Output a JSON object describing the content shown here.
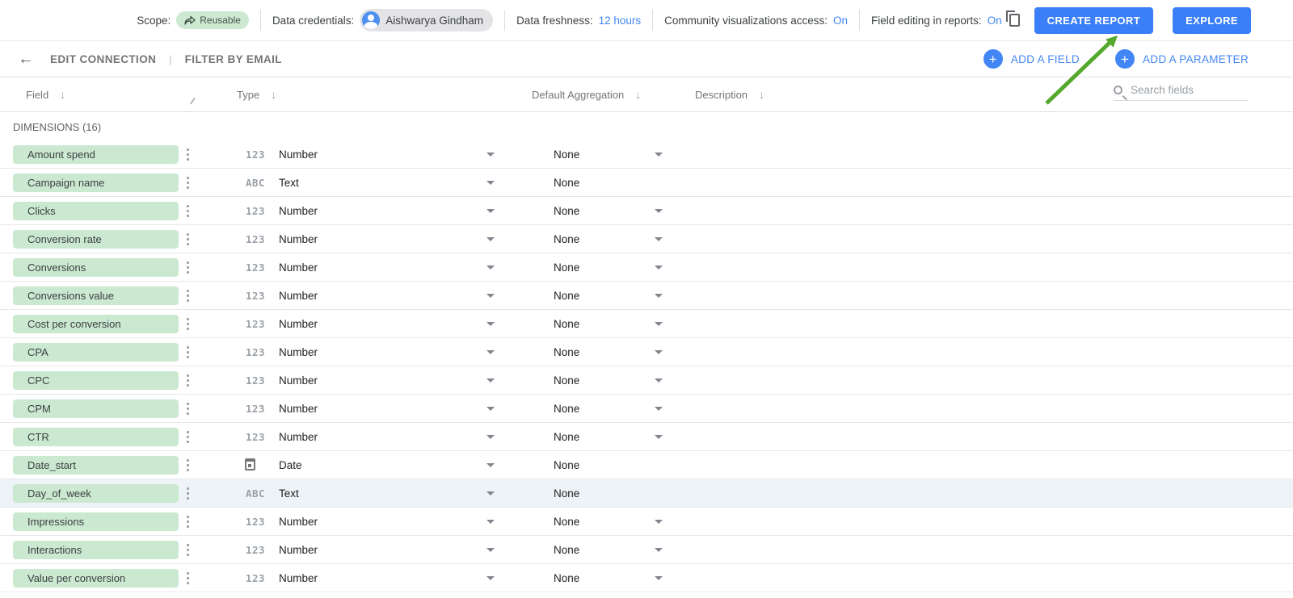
{
  "topbar": {
    "scope_label": "Scope:",
    "scope_value": "Reusable",
    "credentials_label": "Data credentials:",
    "credentials_value": "Aishwarya Gindham",
    "freshness_label": "Data freshness:",
    "freshness_value": "12 hours",
    "community_label": "Community visualizations access:",
    "community_value": "On",
    "field_editing_label": "Field editing in reports:",
    "field_editing_value": "On",
    "create_report_label": "CREATE REPORT",
    "explore_label": "EXPLORE"
  },
  "toolbar": {
    "edit_connection_label": "EDIT CONNECTION",
    "separator": "|",
    "filter_by_email_label": "FILTER BY EMAIL",
    "add_field_label": "ADD A FIELD",
    "add_parameter_label": "ADD A PARAMETER"
  },
  "table": {
    "columns": [
      {
        "label": "Field"
      },
      {
        "label": "Type"
      },
      {
        "label": "Default Aggregation"
      },
      {
        "label": "Description"
      }
    ],
    "search_placeholder": "Search fields",
    "section_label": "DIMENSIONS (16)",
    "rows": [
      {
        "name": "Amount spend",
        "type_icon": "number-type-icon",
        "type_glyph": "123",
        "type_label": "Number",
        "aggregation": "None",
        "has_agg_dropdown": true,
        "highlighted": false
      },
      {
        "name": "Campaign name",
        "type_icon": "text-type-icon",
        "type_glyph": "ABC",
        "type_label": "Text",
        "aggregation": "None",
        "has_agg_dropdown": false,
        "highlighted": false
      },
      {
        "name": "Clicks",
        "type_icon": "number-type-icon",
        "type_glyph": "123",
        "type_label": "Number",
        "aggregation": "None",
        "has_agg_dropdown": true,
        "highlighted": false
      },
      {
        "name": "Conversion rate",
        "type_icon": "number-type-icon",
        "type_glyph": "123",
        "type_label": "Number",
        "aggregation": "None",
        "has_agg_dropdown": true,
        "highlighted": false
      },
      {
        "name": "Conversions",
        "type_icon": "number-type-icon",
        "type_glyph": "123",
        "type_label": "Number",
        "aggregation": "None",
        "has_agg_dropdown": true,
        "highlighted": false
      },
      {
        "name": "Conversions value",
        "type_icon": "number-type-icon",
        "type_glyph": "123",
        "type_label": "Number",
        "aggregation": "None",
        "has_agg_dropdown": true,
        "highlighted": false
      },
      {
        "name": "Cost per conversion",
        "type_icon": "number-type-icon",
        "type_glyph": "123",
        "type_label": "Number",
        "aggregation": "None",
        "has_agg_dropdown": true,
        "highlighted": false
      },
      {
        "name": "CPA",
        "type_icon": "number-type-icon",
        "type_glyph": "123",
        "type_label": "Number",
        "aggregation": "None",
        "has_agg_dropdown": true,
        "highlighted": false
      },
      {
        "name": "CPC",
        "type_icon": "number-type-icon",
        "type_glyph": "123",
        "type_label": "Number",
        "aggregation": "None",
        "has_agg_dropdown": true,
        "highlighted": false
      },
      {
        "name": "CPM",
        "type_icon": "number-type-icon",
        "type_glyph": "123",
        "type_label": "Number",
        "aggregation": "None",
        "has_agg_dropdown": true,
        "highlighted": false
      },
      {
        "name": "CTR",
        "type_icon": "number-type-icon",
        "type_glyph": "123",
        "type_label": "Number",
        "aggregation": "None",
        "has_agg_dropdown": true,
        "highlighted": false
      },
      {
        "name": "Date_start",
        "type_icon": "date-type-icon",
        "type_glyph": "",
        "type_label": "Date",
        "aggregation": "None",
        "has_agg_dropdown": false,
        "highlighted": false
      },
      {
        "name": "Day_of_week",
        "type_icon": "text-type-icon",
        "type_glyph": "ABC",
        "type_label": "Text",
        "aggregation": "None",
        "has_agg_dropdown": false,
        "highlighted": true
      },
      {
        "name": "Impressions",
        "type_icon": "number-type-icon",
        "type_glyph": "123",
        "type_label": "Number",
        "aggregation": "None",
        "has_agg_dropdown": true,
        "highlighted": false
      },
      {
        "name": "Interactions",
        "type_icon": "number-type-icon",
        "type_glyph": "123",
        "type_label": "Number",
        "aggregation": "None",
        "has_agg_dropdown": true,
        "highlighted": false
      },
      {
        "name": "Value per conversion",
        "type_icon": "number-type-icon",
        "type_glyph": "123",
        "type_label": "Number",
        "aggregation": "None",
        "has_agg_dropdown": true,
        "highlighted": false
      }
    ]
  },
  "colors": {
    "accent_blue": "#3a7ff7",
    "link_blue": "#4285f4",
    "pill_green": "#cbe8d0",
    "annotation_green": "#54a82b",
    "highlight_row": "#eef3f8"
  }
}
